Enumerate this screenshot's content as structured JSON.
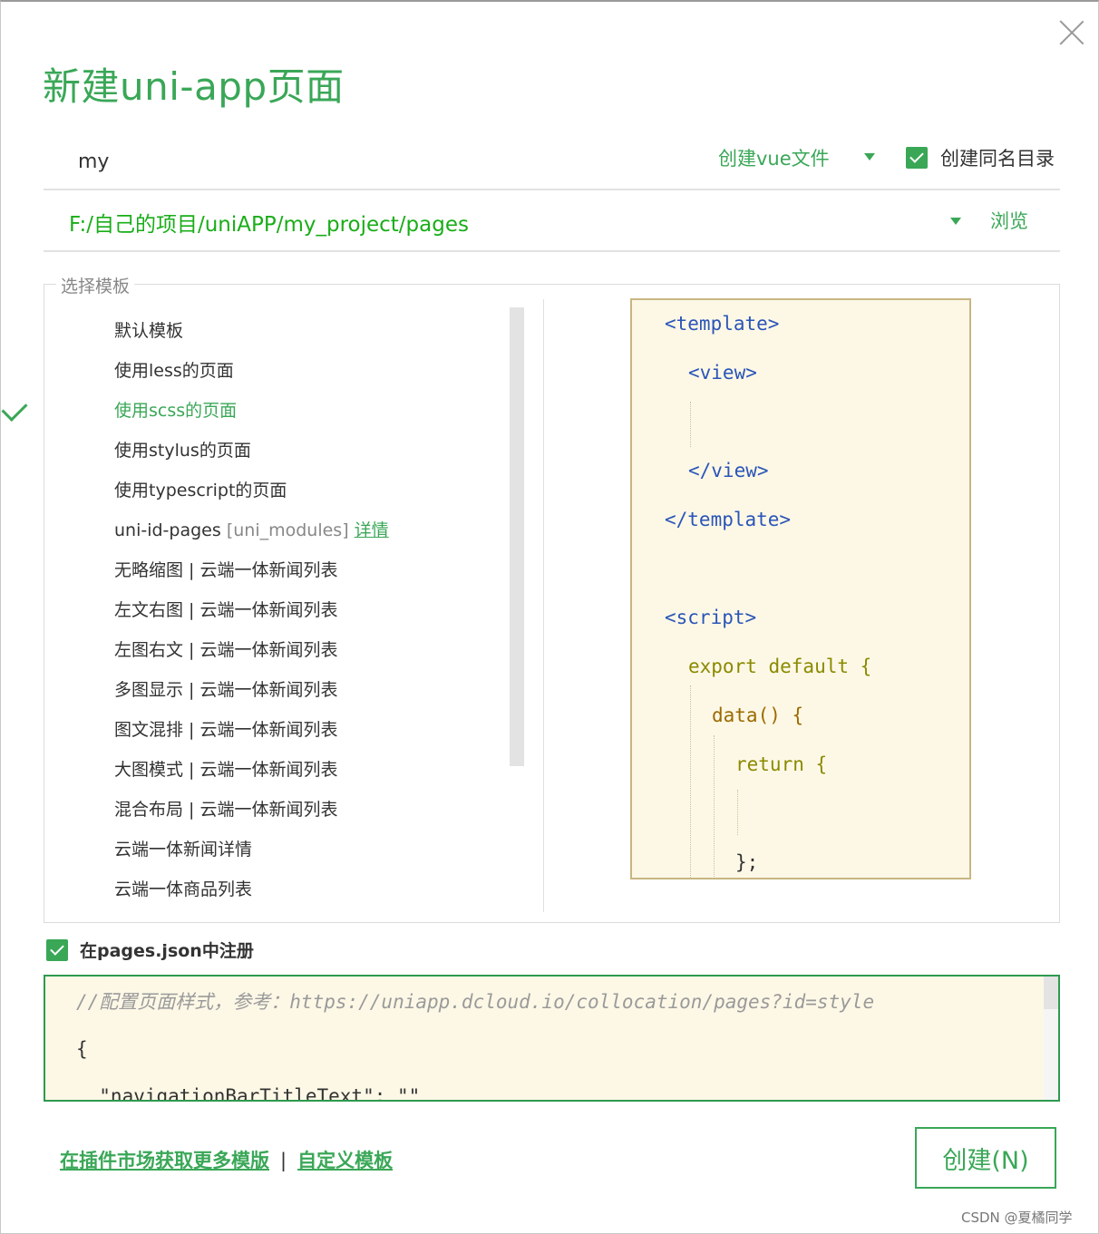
{
  "dialog": {
    "title": "新建uni-app页面",
    "close_icon": "close-icon"
  },
  "form": {
    "page_name": "my",
    "file_type": "创建vue文件",
    "create_same_dir_label": "创建同名目录",
    "create_same_dir_checked": true,
    "path": "F:/自己的项目/uniAPP/my_project/pages",
    "browse_label": "浏览"
  },
  "templates": {
    "legend": "选择模板",
    "selected_index": 2,
    "items": [
      {
        "label": "默认模板"
      },
      {
        "label": "使用less的页面"
      },
      {
        "label": "使用scss的页面"
      },
      {
        "label": "使用stylus的页面"
      },
      {
        "label": "使用typescript的页面"
      },
      {
        "label": "uni-id-pages",
        "sub": "[uni_modules]",
        "link": "详情"
      },
      {
        "label": "无略缩图 | 云端一体新闻列表"
      },
      {
        "label": "左文右图 | 云端一体新闻列表"
      },
      {
        "label": "左图右文 | 云端一体新闻列表"
      },
      {
        "label": "多图显示 | 云端一体新闻列表"
      },
      {
        "label": "图文混排 | 云端一体新闻列表"
      },
      {
        "label": "大图模式 | 云端一体新闻列表"
      },
      {
        "label": "混合布局 | 云端一体新闻列表"
      },
      {
        "label": "云端一体新闻详情"
      },
      {
        "label": "云端一体商品列表"
      }
    ]
  },
  "preview": {
    "lines": [
      {
        "text": "<template>",
        "cls": "tag"
      },
      {
        "text": "<view>",
        "cls": "tag"
      },
      {
        "text": "</view>",
        "cls": "tag"
      },
      {
        "text": "</template>",
        "cls": "tag"
      },
      {
        "text": "<script>",
        "cls": "tag"
      },
      {
        "text": "export default {",
        "cls": "kw"
      },
      {
        "text": "data() {",
        "cls": "fn"
      },
      {
        "text": "return {",
        "cls": "kw"
      },
      {
        "text": "};",
        "cls": "plain"
      }
    ]
  },
  "register": {
    "label": "在pages.json中注册",
    "checked": true,
    "json_lines": [
      "//配置页面样式，参考：https://uniapp.dcloud.io/collocation/pages?id=style",
      "{",
      "  \"navigationBarTitleText\": \"\""
    ]
  },
  "footer": {
    "market_link": "在插件市场获取更多模版",
    "separator": "|",
    "custom_link": "自定义模板",
    "create_button": "创建(N)"
  },
  "watermark": "CSDN @夏橘同学",
  "colors": {
    "accent": "#3aa757",
    "path_green": "#1aad19",
    "preview_bg": "#fdf8e6",
    "preview_border": "#c8b682",
    "tag_blue": "#2a55b8"
  }
}
